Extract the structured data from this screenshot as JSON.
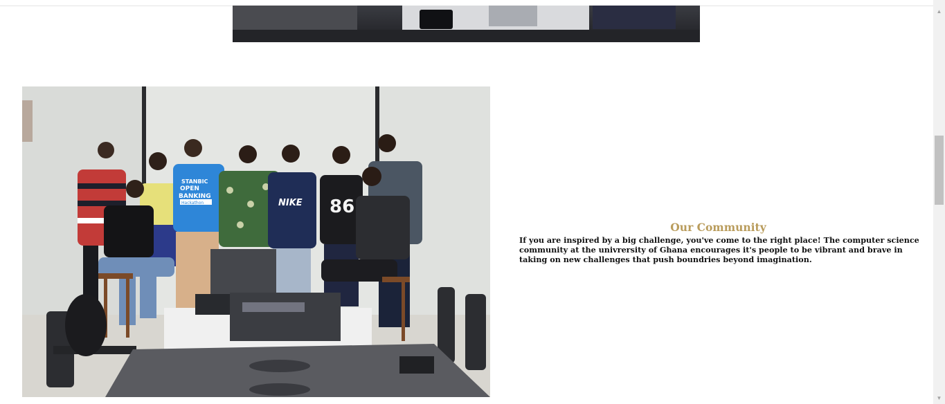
{
  "community": {
    "title": "Our Community",
    "body": "If you are inspired by a big challenge, you've come to the right place! The computer science community at the univrersity of Ghana encourages it's people to be vibrant and brave in taking on new challenges that push boundries beyond imagination.",
    "photo_alt": "Group photo of the computer science community",
    "shirt_text_1": "STANBIC",
    "shirt_text_2": "OPEN",
    "shirt_text_3": "BANKING",
    "shirt_text_4": "Hackathon",
    "shirt_text_nike": "NIKE",
    "shirt_text_86": "86"
  },
  "colors": {
    "accent": "#b99c5c",
    "body_text": "#111111"
  },
  "scrollbar": {
    "up_icon": "chevron-up-icon",
    "down_icon": "chevron-down-icon"
  }
}
